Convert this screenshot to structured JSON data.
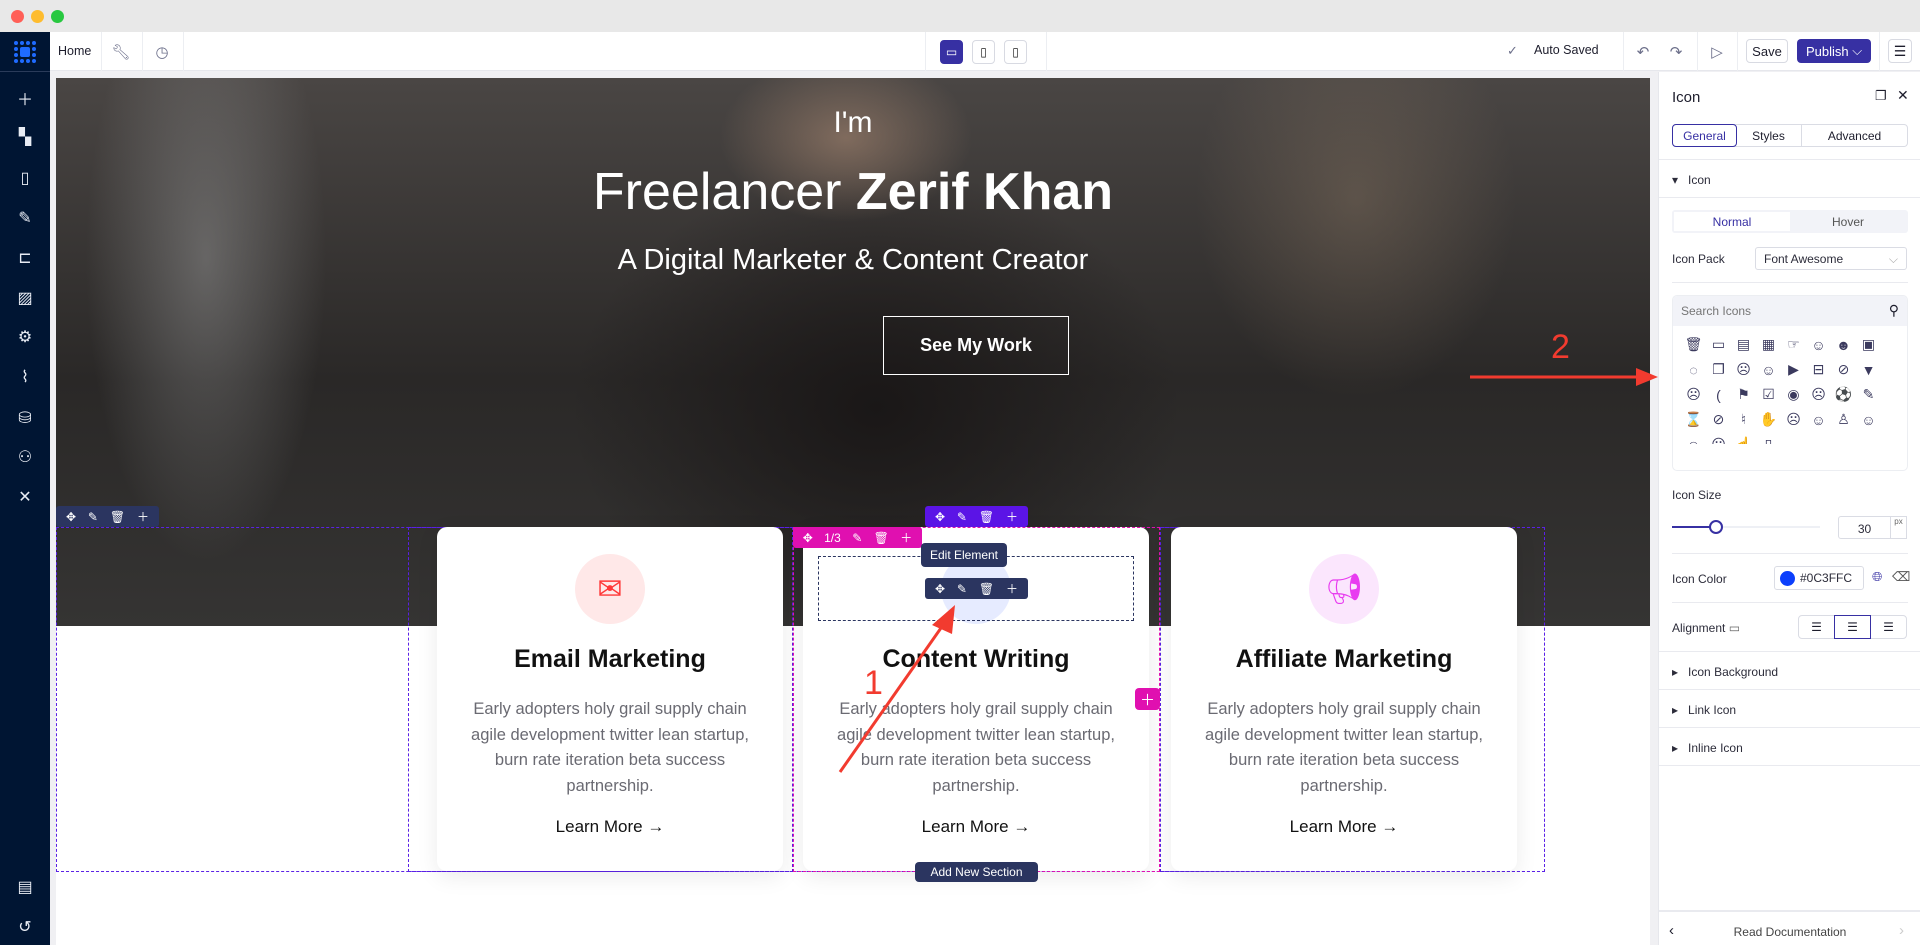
{
  "window": {
    "dots": [
      "#ff5f57",
      "#febc2e",
      "#28c840"
    ]
  },
  "sidebar": {
    "items": [
      "add-icon",
      "widgets-icon",
      "page-icon",
      "design-icon",
      "structure-icon",
      "media-icon",
      "settings-icon",
      "integrations-icon",
      "database-icon",
      "users-icon",
      "tools-icon"
    ],
    "bottom": [
      "notes-icon",
      "history-icon"
    ]
  },
  "topbar": {
    "page": "Home",
    "auto_saved": "Auto Saved",
    "save": "Save",
    "publish": "Publish",
    "devices": [
      "desktop",
      "tablet",
      "mobile"
    ],
    "active_device": "desktop"
  },
  "hero": {
    "line1": "I'm",
    "title_regular": "Freelancer ",
    "title_bold": "Zerif Khan",
    "subtitle": "A Digital Marketer & Content Creator",
    "button": "See My Work"
  },
  "cards": [
    {
      "title": "Email Marketing",
      "desc": "Early adopters holy grail supply chain agile development twitter lean startup, burn rate iteration beta success partnership.",
      "link": "Learn More",
      "icon": "envelope-wallet-icon",
      "color": "#ff3838",
      "bg": "#ffe8e8"
    },
    {
      "title": "Content Writing",
      "desc": "Early adopters holy grail supply chain agile development twitter lean startup, burn rate iteration beta success partnership.",
      "link": "Learn More",
      "icon": "pen-icon",
      "color": "#0c3ffc",
      "bg": "#e6ebff"
    },
    {
      "title": "Affiliate Marketing",
      "desc": "Early adopters holy grail supply chain agile development twitter lean startup, burn rate iteration beta success partnership.",
      "link": "Learn More",
      "icon": "megaphone-icon",
      "color": "#e83cf0",
      "bg": "#fbe6fd"
    }
  ],
  "editor": {
    "column_index": "1/3",
    "tooltip": "Edit Element",
    "add_section": "Add New Section"
  },
  "annotations": {
    "one": "1",
    "two": "2"
  },
  "panel": {
    "title": "Icon",
    "tabs": [
      "General",
      "Styles",
      "Advanced"
    ],
    "active_tab": "General",
    "section": "Icon",
    "states": [
      "Normal",
      "Hover"
    ],
    "active_state": "Normal",
    "icon_pack_label": "Icon Pack",
    "icon_pack": "Font Awesome",
    "search_placeholder": "Search Icons",
    "icons": [
      "🗑",
      "▭",
      "▤",
      "▦",
      "☞",
      "☺",
      "☻",
      "▣",
      "◌",
      "❐",
      "☹",
      "☺",
      "▶",
      "⊟",
      "⊘",
      "▼",
      "☹",
      "(",
      "⚑",
      "☑",
      "◉",
      "☹",
      "⚽",
      "✎",
      "⌛",
      "⊘",
      "♮",
      "✋",
      "☹",
      "☺",
      "♙",
      "☺",
      "☺",
      "☹",
      "☝",
      "▯"
    ],
    "icon_size_label": "Icon Size",
    "icon_size": 30,
    "icon_size_max": 100,
    "unit": "px",
    "icon_color_label": "Icon Color",
    "icon_color": "#0C3FFC",
    "alignment_label": "Alignment",
    "alignment": "center",
    "collapsed": [
      "Icon Background",
      "Link Icon",
      "Inline Icon"
    ],
    "footer": "Read Documentation"
  }
}
